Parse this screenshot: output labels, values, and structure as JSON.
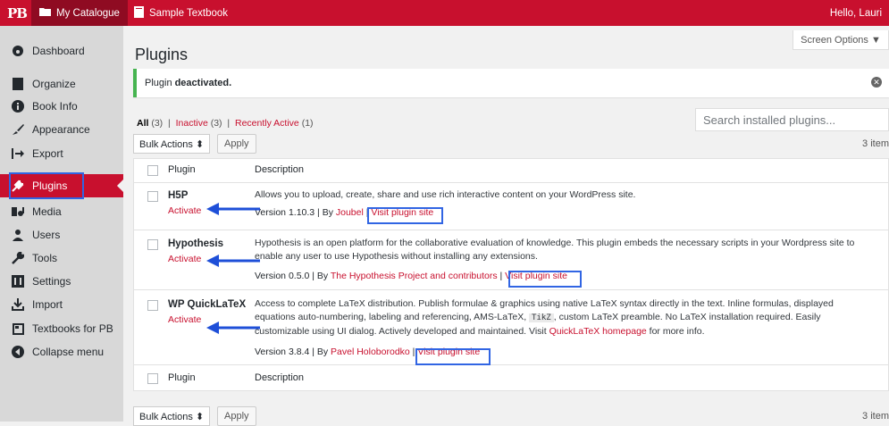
{
  "adminbar": {
    "logo": "PB",
    "catalogue": "My Catalogue",
    "book": "Sample Textbook",
    "hello": "Hello, Lauri",
    "bg_color": "#c8102e"
  },
  "sidebar": {
    "items": [
      {
        "label": "Dashboard",
        "icon": "dashboard-icon"
      },
      {
        "label": "Organize",
        "icon": "book-icon"
      },
      {
        "label": "Book Info",
        "icon": "info-icon"
      },
      {
        "label": "Appearance",
        "icon": "brush-icon"
      },
      {
        "label": "Export",
        "icon": "export-icon"
      },
      {
        "label": "Plugins",
        "icon": "plugin-icon",
        "active": true
      },
      {
        "label": "Media",
        "icon": "media-icon"
      },
      {
        "label": "Users",
        "icon": "users-icon"
      },
      {
        "label": "Tools",
        "icon": "wrench-icon"
      },
      {
        "label": "Settings",
        "icon": "settings-icon"
      },
      {
        "label": "Import",
        "icon": "import-icon"
      },
      {
        "label": "Textbooks for PB",
        "icon": "textbooks-icon"
      },
      {
        "label": "Collapse menu",
        "icon": "collapse-icon"
      }
    ]
  },
  "header": {
    "screen_options": "Screen Options ▼",
    "title": "Plugins"
  },
  "notice": {
    "prefix": "Plugin",
    "strong": "deactivated."
  },
  "filters": {
    "all": "All",
    "all_count": "(3)",
    "sep": "|",
    "inactive": "Inactive",
    "inactive_count": "(3)",
    "recent": "Recently Active",
    "recent_count": "(1)"
  },
  "search": {
    "placeholder": "Search installed plugins..."
  },
  "bulk": {
    "label": "Bulk Actions ⬍",
    "apply": "Apply",
    "count": "3 item"
  },
  "table": {
    "col_plugin": "Plugin",
    "col_description": "Description"
  },
  "plugins": [
    {
      "name": "H5P",
      "action": "Activate",
      "desc1": "Allows you to upload, create, share and use rich interactive content on your WordPress site.",
      "version": "Version 1.10.3 | By",
      "author": "Joubel",
      "visit": "Visit plugin site"
    },
    {
      "name": "Hypothesis",
      "action": "Activate",
      "desc1": "Hypothesis is an open platform for the collaborative evaluation of knowledge. This plugin embeds the necessary scripts in your Wordpress site to",
      "desc2": "enable any user to use Hypothesis without installing any extensions.",
      "version": "Version 0.5.0 | By",
      "author": "The Hypothesis Project and contributors",
      "visit": "Visit plugin site"
    },
    {
      "name": "WP QuickLaTeX",
      "action": "Activate",
      "desc1": "Access to complete LaTeX distribution. Publish formulae & graphics using native LaTeX syntax directly in the text. Inline formulas, displayed",
      "desc2a": "equations auto-numbering, labeling and referencing, AMS-LaTeX,",
      "desc2code": "TikZ",
      "desc2b": ", custom LaTeX preamble. No LaTeX installation required. Easily",
      "desc3a": "customizable using UI dialog. Actively developed and maintained. Visit",
      "desc3link": "QuickLaTeX homepage",
      "desc3b": "for more info.",
      "version": "Version 3.8.4 | By",
      "author": "Pavel Holoborodko",
      "visit": "Visit plugin site"
    }
  ],
  "colors": {
    "accent": "#c8102e",
    "highlight": "#3165e3",
    "success": "#46b450"
  }
}
